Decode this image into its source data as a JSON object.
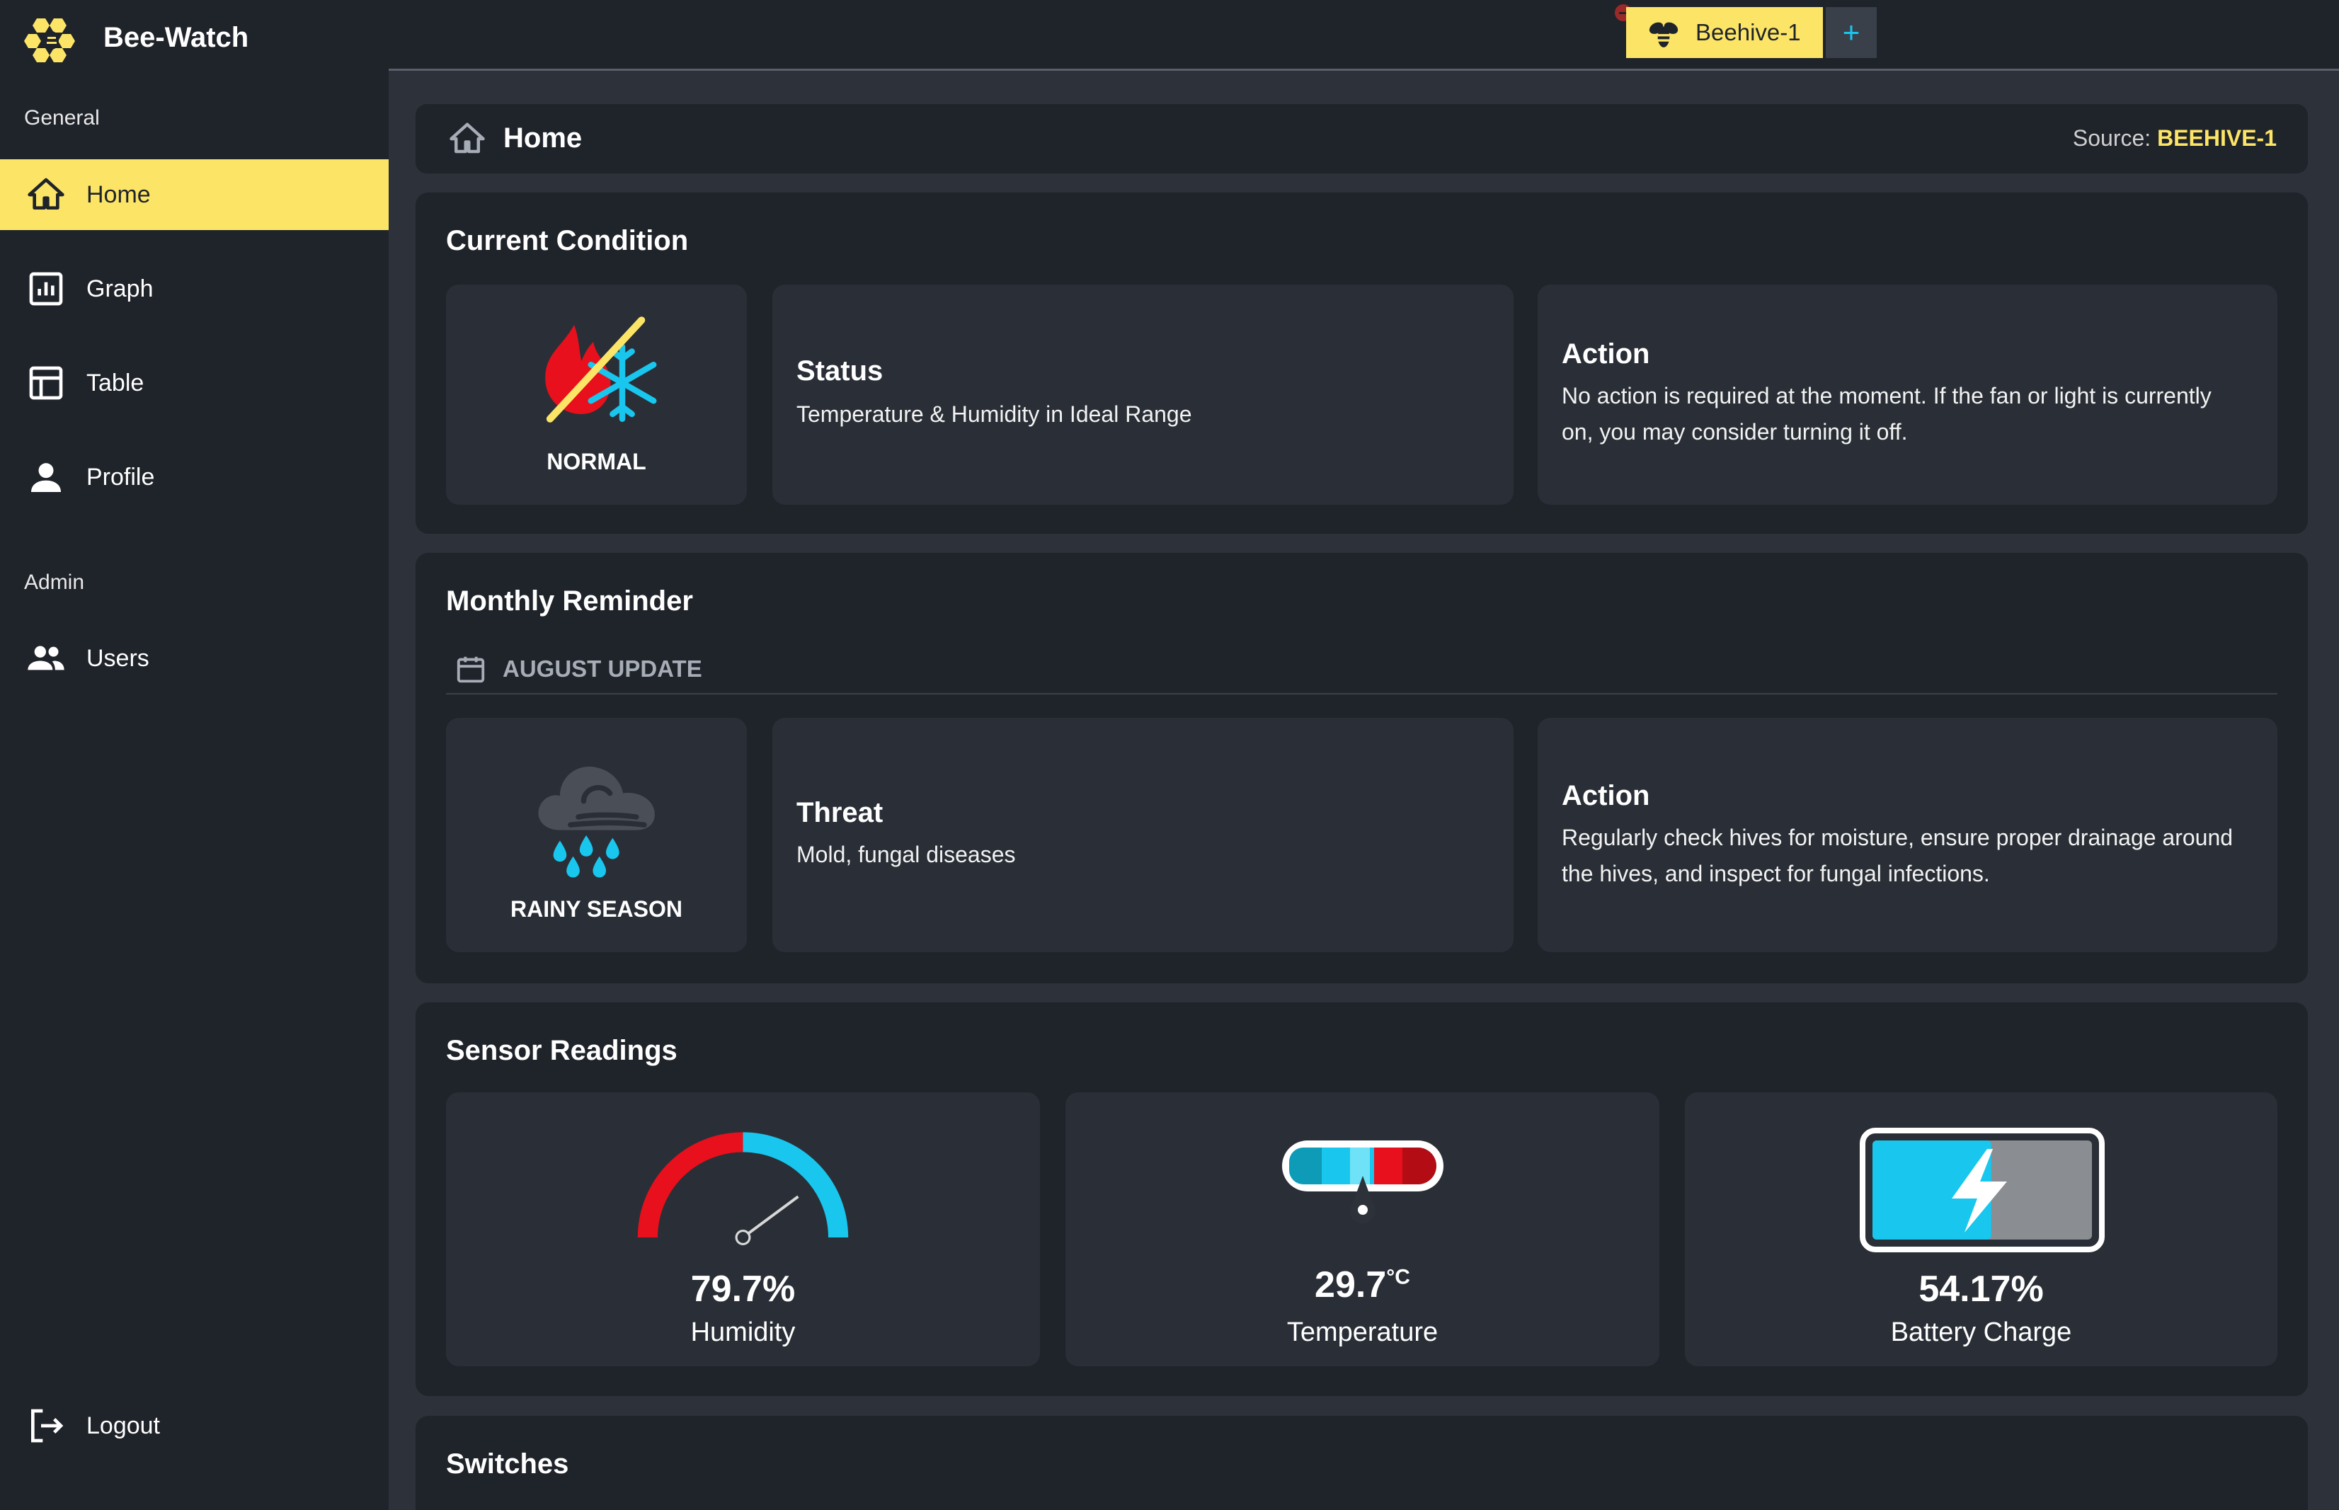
{
  "app": {
    "title": "Bee-Watch"
  },
  "sidebar": {
    "general_label": "General",
    "admin_label": "Admin",
    "items": [
      {
        "label": "Home",
        "icon": "home-icon",
        "active": true
      },
      {
        "label": "Graph",
        "icon": "bar-chart-icon"
      },
      {
        "label": "Table",
        "icon": "table-icon"
      },
      {
        "label": "Profile",
        "icon": "person-icon"
      }
    ],
    "admin_items": [
      {
        "label": "Users",
        "icon": "users-icon"
      }
    ],
    "logout_label": "Logout"
  },
  "tabs": {
    "active_label": "Beehive-1",
    "add_label": "+"
  },
  "header": {
    "title": "Home",
    "source_label": "Source:",
    "source_value": "BEEHIVE-1"
  },
  "current_condition": {
    "title": "Current Condition",
    "state_label": "NORMAL",
    "status_heading": "Status",
    "status_text": "Temperature & Humidity in Ideal Range",
    "action_heading": "Action",
    "action_text": "No action is required at the moment. If the fan or light is currently on, you may consider turning it off."
  },
  "monthly_reminder": {
    "title": "Monthly Reminder",
    "update_label": "AUGUST UPDATE",
    "season_label": "RAINY SEASON",
    "threat_heading": "Threat",
    "threat_text": "Mold, fungal diseases",
    "action_heading": "Action",
    "action_text": "Regularly check hives for moisture, ensure proper drainage around the hives, and inspect for fungal infections."
  },
  "sensors": {
    "title": "Sensor Readings",
    "humidity": {
      "value": "79.7%",
      "label": "Humidity",
      "level": 79.7
    },
    "temperature": {
      "value": "29.7",
      "unit": "°C",
      "label": "Temperature"
    },
    "battery": {
      "value": "54.17%",
      "label": "Battery Charge",
      "level": 54.17
    }
  },
  "switches": {
    "title": "Switches"
  },
  "colors": {
    "accent": "#fce566",
    "cyan": "#19c6ee",
    "red": "#e8101c",
    "panel": "#1f232a",
    "card": "#2a2f37"
  }
}
